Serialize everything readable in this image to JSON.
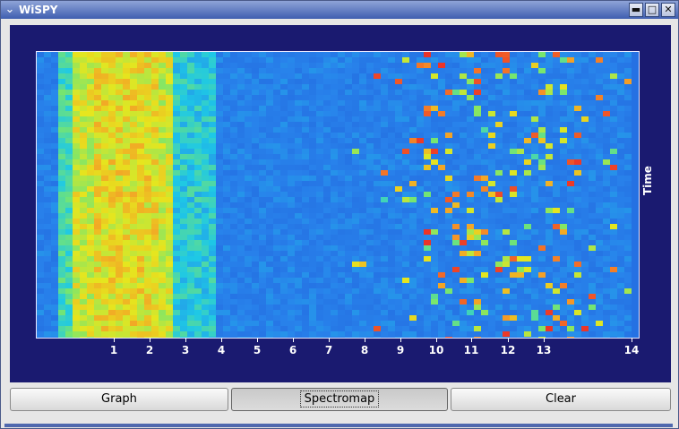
{
  "window": {
    "title": "WiSPY",
    "menu_glyph": "⌄",
    "min_glyph": "▬",
    "max_glyph": "□",
    "close_glyph": "✕"
  },
  "plot": {
    "ylabel": "Time",
    "x_ticks": [
      "1",
      "2",
      "3",
      "4",
      "5",
      "6",
      "7",
      "8",
      "9",
      "10",
      "11",
      "12",
      "13",
      "14"
    ],
    "x_range": [
      1,
      14
    ],
    "colors": {
      "background_panel": "#1a1a70",
      "low": "#2a78e0",
      "mid": "#20d0e0",
      "high": "#e8e020",
      "peak": "#e84030"
    }
  },
  "buttons": {
    "graph": "Graph",
    "spectromap": "Spectromap",
    "clear": "Clear"
  },
  "chart_data": {
    "type": "heatmap",
    "ylabel": "Time",
    "xticks": [
      "1",
      "2",
      "3",
      "4",
      "5",
      "6",
      "7",
      "8",
      "9",
      "10",
      "11",
      "12",
      "13",
      "14"
    ],
    "hotspots": [
      {
        "x_range": [
          0.5,
          2.5
        ],
        "intensity": "high"
      },
      {
        "x_range": [
          9.8,
          13.2
        ],
        "intensity": "sporadic"
      }
    ]
  }
}
